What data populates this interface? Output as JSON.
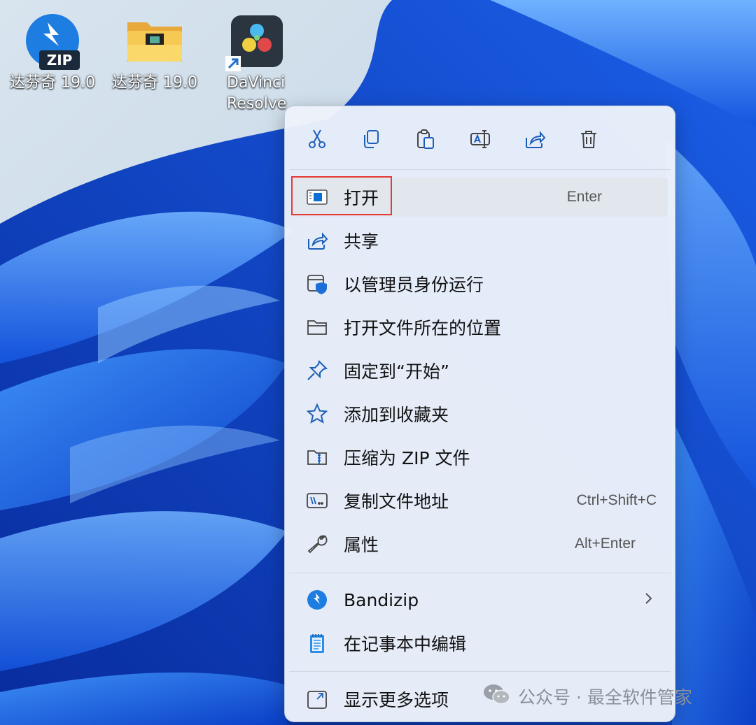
{
  "desktop": {
    "icons": [
      {
        "label": "达芬奇 19.0",
        "icon": "bandizip-zip-icon"
      },
      {
        "label": "达芬奇 19.0",
        "icon": "folder-icon"
      },
      {
        "label": "DaVinci\nResolve",
        "icon": "davinci-resolve-icon"
      }
    ]
  },
  "context_menu": {
    "toolbar": [
      "cut-icon",
      "copy-icon",
      "paste-icon",
      "rename-icon",
      "share-icon",
      "delete-icon"
    ],
    "items": [
      {
        "label": "打开",
        "shortcut": "Enter",
        "icon": "open-window-icon"
      },
      {
        "label": "共享",
        "shortcut": "",
        "icon": "share-icon"
      },
      {
        "label": "以管理员身份运行",
        "shortcut": "",
        "icon": "admin-shield-icon"
      },
      {
        "label": "打开文件所在的位置",
        "shortcut": "",
        "icon": "folder-icon"
      },
      {
        "label": "固定到“开始”",
        "shortcut": "",
        "icon": "pin-icon"
      },
      {
        "label": "添加到收藏夹",
        "shortcut": "",
        "icon": "star-icon"
      },
      {
        "label": "压缩为 ZIP 文件",
        "shortcut": "",
        "icon": "zip-folder-icon"
      },
      {
        "label": "复制文件地址",
        "shortcut": "Ctrl+Shift+C",
        "icon": "copy-path-icon"
      },
      {
        "label": "属性",
        "shortcut": "Alt+Enter",
        "icon": "wrench-icon"
      },
      {
        "label": "Bandizip",
        "shortcut": "",
        "icon": "bandizip-icon"
      },
      {
        "label": "在记事本中编辑",
        "shortcut": "",
        "icon": "notepad-icon"
      },
      {
        "label": "显示更多选项",
        "shortcut": "",
        "icon": "more-options-icon"
      }
    ]
  },
  "watermark": {
    "text": "公众号 · 最全软件管家"
  },
  "colors": {
    "accent": "#0067c0",
    "highlight_border": "#e53935",
    "menu_bg": "#ecf2fa"
  }
}
